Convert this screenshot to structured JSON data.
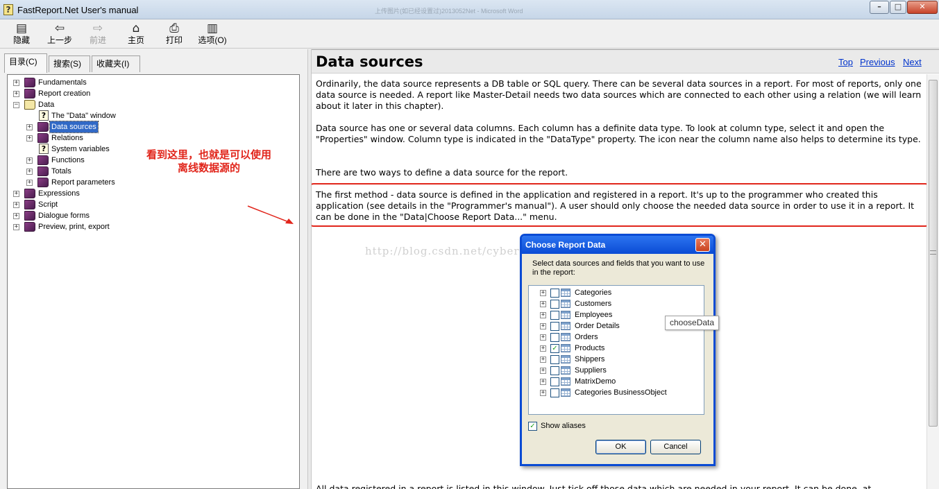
{
  "window": {
    "title": "FastReport.Net User's manual",
    "ghost_title": "上传图片(如已经设置过)2013052Net - Microsoft Word",
    "controls": {
      "minimize": "–",
      "maximize": "□",
      "close": "✕"
    }
  },
  "toolbar": {
    "buttons": [
      {
        "label": "隐藏",
        "icon": "hide-icon",
        "glyph": "▤"
      },
      {
        "label": "上一步",
        "icon": "back-arrow-icon",
        "glyph": "⇦"
      },
      {
        "label": "前进",
        "icon": "forward-arrow-icon",
        "glyph": "⇨"
      },
      {
        "label": "主页",
        "icon": "home-icon",
        "glyph": "⌂"
      },
      {
        "label": "打印",
        "icon": "printer-icon",
        "glyph": "⎙"
      },
      {
        "label": "选项(O)",
        "icon": "options-icon",
        "glyph": "▥"
      }
    ]
  },
  "tabs": [
    {
      "label": "目录(C)"
    },
    {
      "label": "搜索(S)"
    },
    {
      "label": "收藏夹(I)"
    }
  ],
  "tree": {
    "items": [
      {
        "label": "Fundamentals",
        "expander": "+"
      },
      {
        "label": "Report creation",
        "expander": "+"
      },
      {
        "label": "Data",
        "expander": "−"
      },
      {
        "label": "The \"Data\" window",
        "expander": ""
      },
      {
        "label": "Data sources",
        "expander": "+"
      },
      {
        "label": "Relations",
        "expander": "+"
      },
      {
        "label": "System variables",
        "expander": ""
      },
      {
        "label": "Functions",
        "expander": "+"
      },
      {
        "label": "Totals",
        "expander": "+"
      },
      {
        "label": "Report parameters",
        "expander": "+"
      },
      {
        "label": "Expressions",
        "expander": "+"
      },
      {
        "label": "Script",
        "expander": "+"
      },
      {
        "label": "Dialogue forms",
        "expander": "+"
      },
      {
        "label": "Preview, print, export",
        "expander": "+"
      }
    ]
  },
  "annotation": {
    "line1": "看到这里，也就是可以使用",
    "line2": "离线数据源的"
  },
  "topic": {
    "title": "Data sources",
    "nav": {
      "top": "Top",
      "previous": "Previous",
      "next": "Next"
    },
    "paragraphs": [
      "Ordinarily, the data source represents a DB table or SQL query. There can be several data sources in a report. For most of reports, only one data source is needed. A report like Master-Detail needs two data sources which are connected to each other using a relation (we will learn about it later in this chapter).",
      "Data source has one or several data columns. Each column has a definite data type. To look at column type, select it and open the \"Properties\" window. Column type is indicated in the \"DataType\" property. The icon near the column name also helps to determine its type.",
      "There are two ways to define a data source for the report.",
      "The first method - data source is defined in the application and registered in a report. It's up to the programmer who created this application (see details in the \"Programmer's manual\"). A user should only choose the needed data source in order to use it in a report. It can be done in the \"Data|Choose Report Data...\" menu.",
      "All data registered in a report is listed in this window. Just tick off those data which are needed in your report. It can be done, at"
    ],
    "watermark": "http://blog.csdn.net/cyberzhaohy"
  },
  "dialog": {
    "title": "Choose Report Data",
    "description": "Select data sources and fields that you want to use in the report:",
    "items": [
      {
        "name": "Categories",
        "checked": ""
      },
      {
        "name": "Customers",
        "checked": ""
      },
      {
        "name": "Employees",
        "checked": ""
      },
      {
        "name": "Order Details",
        "checked": ""
      },
      {
        "name": "Orders",
        "checked": ""
      },
      {
        "name": "Products",
        "checked": "✓"
      },
      {
        "name": "Shippers",
        "checked": ""
      },
      {
        "name": "Suppliers",
        "checked": ""
      },
      {
        "name": "MatrixDemo",
        "checked": ""
      },
      {
        "name": "Categories BusinessObject",
        "checked": ""
      }
    ],
    "show_aliases": {
      "label": "Show aliases",
      "checked": "✓"
    },
    "ok": "OK",
    "cancel": "Cancel",
    "close": "✕"
  },
  "tooltip": "chooseData",
  "colors": {
    "accent": "#0a4bd4",
    "annotation": "#e1251b",
    "link": "#0033cc",
    "selection": "#3169c6"
  }
}
